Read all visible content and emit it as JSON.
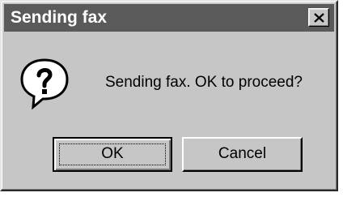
{
  "window": {
    "title": "Sending fax"
  },
  "dialog": {
    "icon": "question-icon",
    "message": "Sending fax. OK to proceed?",
    "ok_label": "OK",
    "cancel_label": "Cancel"
  },
  "colors": {
    "titlebar": "#5a5a5a",
    "face": "#c6c6c6",
    "title_text": "#ffffff"
  }
}
